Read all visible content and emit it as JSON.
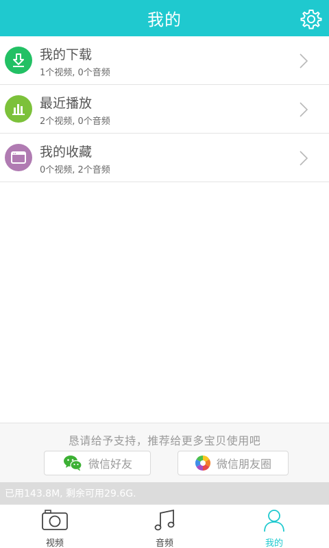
{
  "header": {
    "title": "我的",
    "settings_icon": "gear-icon"
  },
  "list": [
    {
      "title": "我的下载",
      "subtitle": "1个视频, 0个音频",
      "icon": "download-icon",
      "color": "#22c064"
    },
    {
      "title": "最近播放",
      "subtitle": "2个视频, 0个音频",
      "icon": "bar-chart-icon",
      "color": "#7cc13a"
    },
    {
      "title": "我的收藏",
      "subtitle": "0个视频, 2个音频",
      "icon": "folder-icon",
      "color": "#b07bb2"
    }
  ],
  "share": {
    "prompt": "恳请给予支持，推荐给更多宝贝使用吧",
    "wechat_friend": "微信好友",
    "wechat_moments": "微信朋友圈"
  },
  "storage": {
    "text": "已用143.8M, 剩余可用29.6G."
  },
  "nav": [
    {
      "label": "视频",
      "icon": "camera-icon",
      "active": false
    },
    {
      "label": "音频",
      "icon": "music-note-icon",
      "active": false
    },
    {
      "label": "我的",
      "icon": "person-icon",
      "active": true
    }
  ],
  "colors": {
    "accent": "#1fc9cf",
    "download": "#22c064",
    "recent": "#7cc13a",
    "favorites": "#b07bb2"
  }
}
